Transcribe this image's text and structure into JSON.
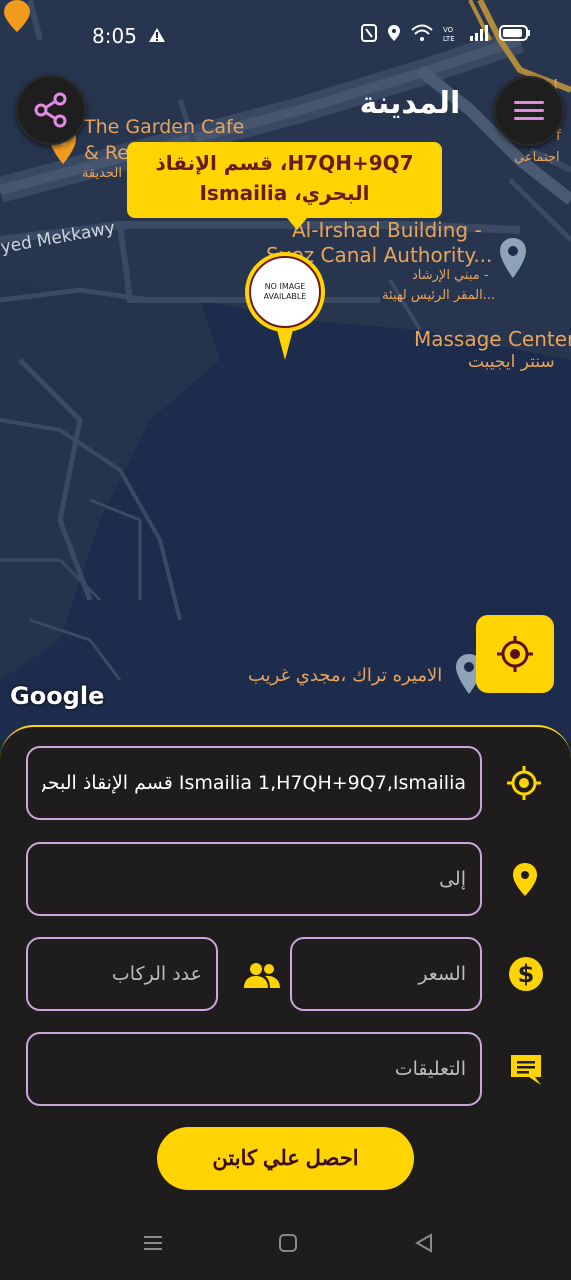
{
  "status_bar": {
    "time": "8:05"
  },
  "header": {
    "title": "المدينة"
  },
  "map": {
    "labels": {
      "garden_cafe": "The Garden Cafe",
      "garden_cafe_2": "& Re",
      "garden_cafe_ar": "الحديقة",
      "mekkawy": "yed Mekkawy",
      "irshad_1": "Al-Irshad Building -",
      "irshad_2": "Suez Canal Authority...",
      "irshad_ar_1": "مبني الإرشاد -",
      "irshad_ar_2": "المقر الرئيس لهيئة...",
      "massage": "Massage Center",
      "massage_ar": "سنتر ايجيبت",
      "princess": "الاميره تراك ،مجدي غريب",
      "top_right_1": "Al",
      "top_right_2": "f",
      "top_right_ar": "اجتماعي"
    },
    "tooltip": {
      "line1": "H7QH+9Q7، قسم الإنقاذ",
      "line2": "البحري، Ismailia"
    },
    "marker_text": "NO IMAGE AVAILABLE",
    "attribution": "Google"
  },
  "form": {
    "from_value": "Ismailia 1,H7QH+9Q7,Ismailia قسم الإنقاذ البحرى,",
    "to_placeholder": "إلى",
    "price_placeholder": "السعر",
    "passengers_placeholder": "عدد الركاب",
    "comments_placeholder": "التعليقات",
    "submit_label": "احصل علي كابتن"
  },
  "colors": {
    "accent": "#ffd400",
    "panel": "#1e1c1d",
    "field_border": "#c9a6d6",
    "map_bg": "#1d2c4d"
  },
  "icons": {
    "share": "share-icon",
    "menu": "menu-icon",
    "locate": "crosshair-icon",
    "from": "crosshair-icon",
    "to": "location-pin-icon",
    "price": "dollar-icon",
    "passengers": "people-icon",
    "comments": "comment-icon"
  }
}
